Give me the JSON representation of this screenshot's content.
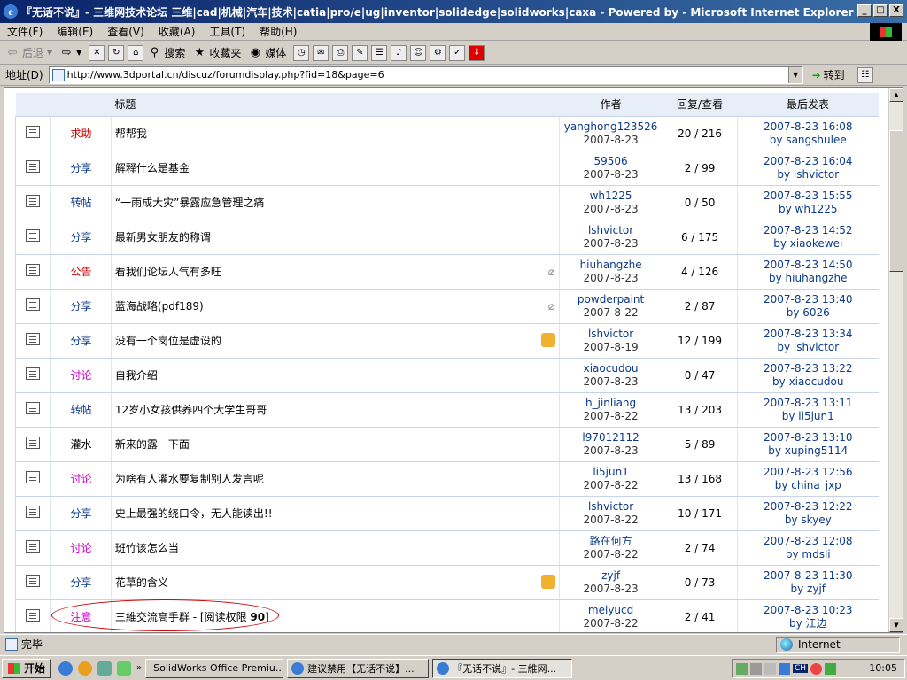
{
  "window": {
    "title": "『无话不说』- 三维网技术论坛 三维|cad|机械|汽车|技术|catia|pro/e|ug|inventor|solidedge|solidworks|caxa - Powered by - Microsoft Internet Explorer",
    "controls": [
      "_",
      "□",
      "X"
    ]
  },
  "menu": [
    "文件(F)",
    "编辑(E)",
    "查看(V)",
    "收藏(A)",
    "工具(T)",
    "帮助(H)"
  ],
  "toolbar": {
    "back": "后退",
    "search": "搜索",
    "favorites": "收藏夹",
    "media": "媒体"
  },
  "address": {
    "label": "地址(D)",
    "url": "http://www.3dportal.cn/discuz/forumdisplay.php?fid=18&page=6",
    "go": "转到"
  },
  "table": {
    "headers": {
      "title": "标题",
      "author": "作者",
      "stats": "回复/查看",
      "last": "最后发表"
    },
    "rows": [
      {
        "cat": "求助",
        "subj": "帮帮我",
        "author": "yanghong123526",
        "date": "2007-8-23",
        "stats": "20 / 216",
        "last_time": "2007-8-23 16:08",
        "last_by": "by sangshulee"
      },
      {
        "cat": "分享",
        "subj": "解释什么是基金",
        "author": "59506",
        "date": "2007-8-23",
        "stats": "2 / 99",
        "last_time": "2007-8-23 16:04",
        "last_by": "by lshvictor"
      },
      {
        "cat": "转帖",
        "subj": "“一雨成大灾”暴露应急管理之痛",
        "author": "wh1225",
        "date": "2007-8-23",
        "stats": "0 / 50",
        "last_time": "2007-8-23 15:55",
        "last_by": "by wh1225"
      },
      {
        "cat": "分享",
        "subj": "最新男女朋友的称谓",
        "author": "lshvictor",
        "date": "2007-8-23",
        "stats": "6 / 175",
        "last_time": "2007-8-23 14:52",
        "last_by": "by xiaokewei"
      },
      {
        "cat": "公告",
        "subj": "看我们论坛人气有多旺",
        "author": "hiuhangzhe",
        "date": "2007-8-23",
        "stats": "4 / 126",
        "last_time": "2007-8-23 14:50",
        "last_by": "by hiuhangzhe"
      },
      {
        "cat": "分享",
        "subj": "蓝海战略(pdf189)",
        "author": "powderpaint",
        "date": "2007-8-22",
        "stats": "2 / 87",
        "last_time": "2007-8-23 13:40",
        "last_by": "by 6026"
      },
      {
        "cat": "分享",
        "subj": "没有一个岗位是虚设的",
        "author": "lshvictor",
        "date": "2007-8-19",
        "stats": "12 / 199",
        "last_time": "2007-8-23 13:34",
        "last_by": "by lshvictor"
      },
      {
        "cat": "讨论",
        "subj": "自我介绍",
        "author": "xiaocudou",
        "date": "2007-8-23",
        "stats": "0 / 47",
        "last_time": "2007-8-23 13:22",
        "last_by": "by xiaocudou"
      },
      {
        "cat": "转帖",
        "subj": "12岁小女孩供养四个大学生哥哥",
        "author": "h_jinliang",
        "date": "2007-8-22",
        "stats": "13 / 203",
        "last_time": "2007-8-23 13:11",
        "last_by": "by li5jun1"
      },
      {
        "cat": "灌水",
        "subj": "新来的露一下面",
        "author": "l97012112",
        "date": "2007-8-23",
        "stats": "5 / 89",
        "last_time": "2007-8-23 13:10",
        "last_by": "by xuping5114"
      },
      {
        "cat": "讨论",
        "subj": "为啥有人灌水要复制别人发言呢",
        "author": "li5jun1",
        "date": "2007-8-22",
        "stats": "13 / 168",
        "last_time": "2007-8-23 12:56",
        "last_by": "by china_jxp"
      },
      {
        "cat": "分享",
        "subj": "史上最强的绕口令，无人能读出!!",
        "author": "lshvictor",
        "date": "2007-8-22",
        "stats": "10 / 171",
        "last_time": "2007-8-23 12:22",
        "last_by": "by skyey"
      },
      {
        "cat": "讨论",
        "subj": "斑竹该怎么当",
        "author": "路在何方",
        "date": "2007-8-22",
        "stats": "2 / 74",
        "last_time": "2007-8-23 12:08",
        "last_by": "by mdsli"
      },
      {
        "cat": "分享",
        "subj": "花草的含义",
        "author": "zyjf",
        "date": "2007-8-23",
        "stats": "0 / 73",
        "last_time": "2007-8-23 11:30",
        "last_by": "by zyjf"
      },
      {
        "cat": "注意",
        "subj": "三維交流高手群",
        "subj_suffix": " - [阅读权限 ",
        "subj_level": "90",
        "subj_close": "]",
        "author": "meiyucd",
        "date": "2007-8-22",
        "stats": "2 / 41",
        "last_time": "2007-8-23 10:23",
        "last_by": "by 江边"
      }
    ]
  },
  "colors": {
    "求助": "#cc0000",
    "公告": "#cc0000",
    "讨论": "#cc00cc",
    "注意": "#cc00cc",
    "分享": "#0b3a8a",
    "转帖": "#0b3a8a",
    "灌水": "#000000"
  },
  "status": {
    "text": "完毕",
    "zone": "Internet"
  },
  "taskbar": {
    "start": "开始",
    "tasks": [
      "SolidWorks Office Premiu...",
      "建议禁用【无话不说】...",
      "『无话不说』- 三維网..."
    ],
    "time": "10:05",
    "lang": "CH"
  }
}
